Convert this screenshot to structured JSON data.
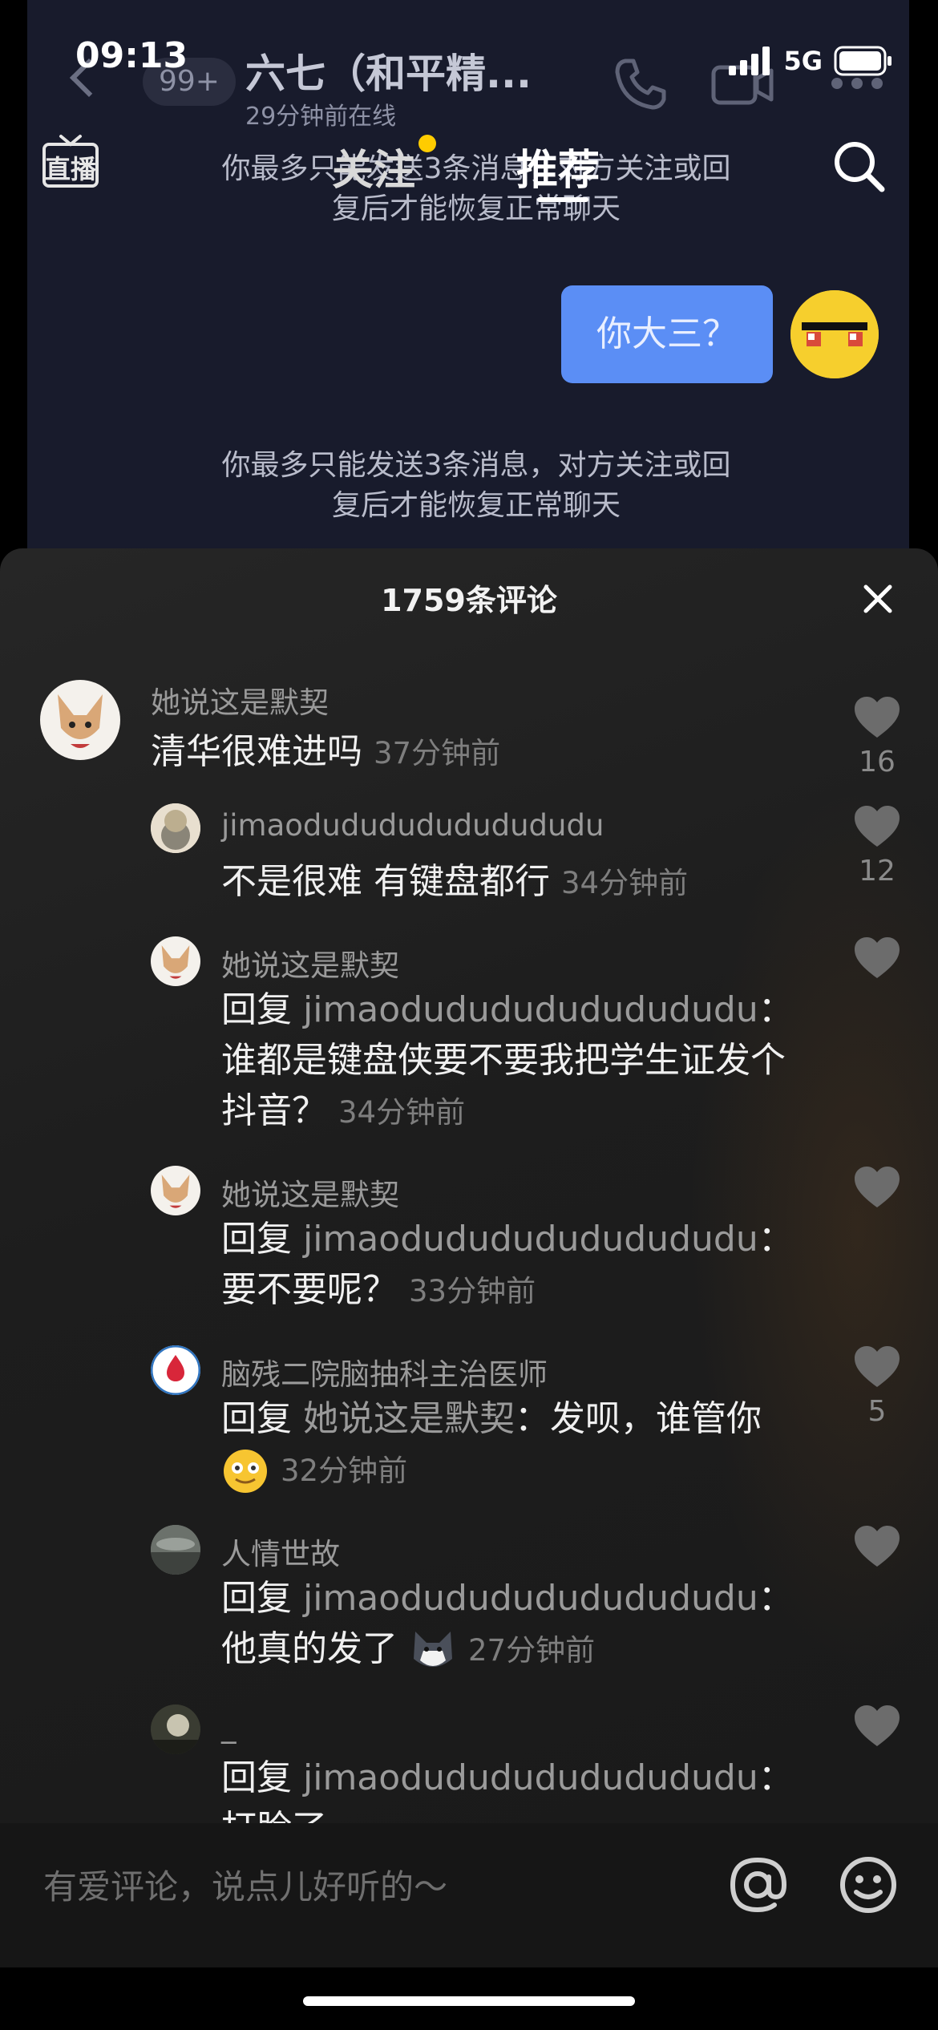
{
  "status_bar": {
    "time": "09:13",
    "network": "5G"
  },
  "chat_video": {
    "unread_badge": "99+",
    "contact_name": "六七（和平精...",
    "last_seen": "29分钟前在线",
    "system_note_line1": "你最多只能发送3条消息，对方关注或回",
    "system_note_line2": "复后才能恢复正常聊天",
    "my_message": "你大三？"
  },
  "top_nav": {
    "live_label": "直播",
    "tab_follow": "关注",
    "tab_recommend": "推荐"
  },
  "comments_sheet": {
    "title": "1759条评论",
    "comments": [
      {
        "name": "她说这是默契",
        "text": "清华很难进吗",
        "time": "37分钟前",
        "likes": "16"
      },
      {
        "name": "jimaodudududududududu",
        "text": "不是很难 有键盘都行",
        "time": "34分钟前",
        "likes": "12"
      },
      {
        "name": "她说这是默契",
        "reply_prefix": "回复",
        "reply_to": "jimaodudududududududu",
        "text": "：谁都是键盘侠要不要我把学生证发个抖音？",
        "time": "34分钟前",
        "likes": ""
      },
      {
        "name": "她说这是默契",
        "reply_prefix": "回复",
        "reply_to": "jimaodudududududududu",
        "text": "：要不要呢？",
        "time": "33分钟前",
        "likes": ""
      },
      {
        "name": "脑残二院脑抽科主治医师",
        "reply_prefix": "回复",
        "reply_to": "她说这是默契",
        "text": "：发呗，谁管你",
        "time": "32分钟前",
        "likes": "5"
      },
      {
        "name": "人情世故",
        "reply_prefix": "回复",
        "reply_to": "jimaodudududududududu",
        "text": "：他真的发了",
        "time": "27分钟前",
        "likes": ""
      },
      {
        "name": "_",
        "reply_prefix": "回复",
        "reply_to": "jimaodudududududududu",
        "text": "：打脸了",
        "time": "",
        "likes": ""
      }
    ]
  },
  "input": {
    "placeholder": "有爱评论，说点儿好听的～"
  }
}
